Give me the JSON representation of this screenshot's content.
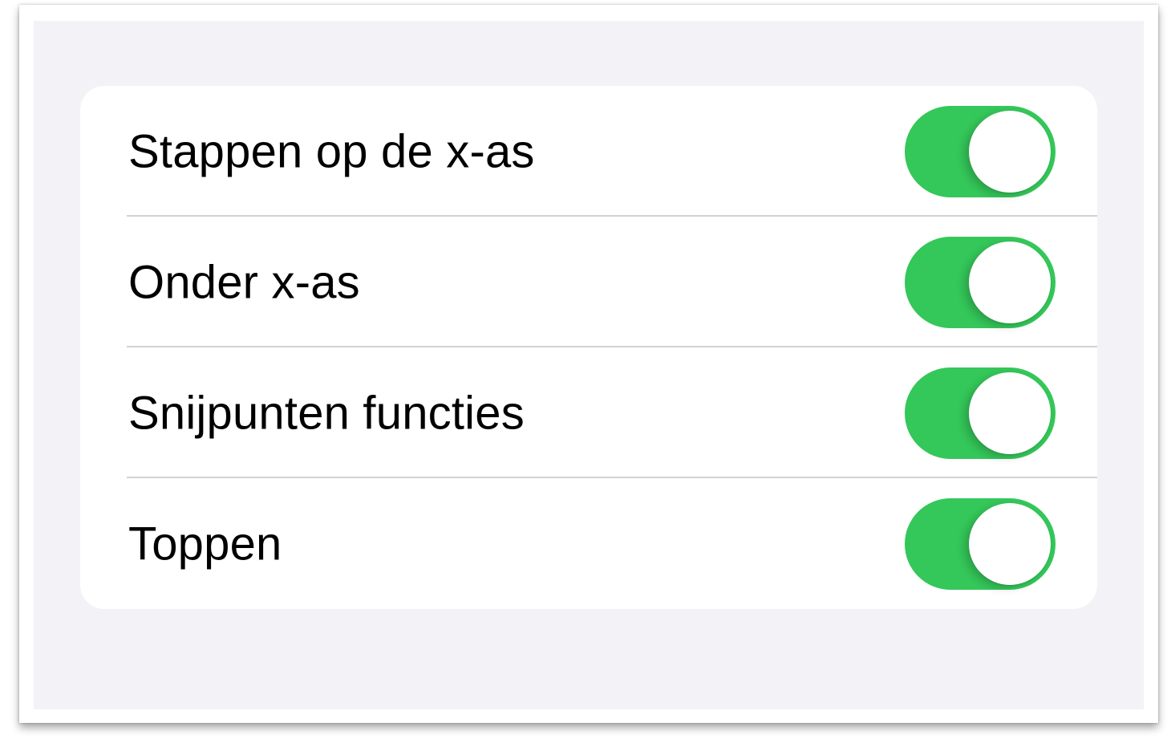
{
  "settings": {
    "accent_color": "#34c759",
    "rows": [
      {
        "label": "Stappen op de x-as",
        "on": true
      },
      {
        "label": "Onder x-as",
        "on": true
      },
      {
        "label": "Snijpunten functies",
        "on": true
      },
      {
        "label": "Toppen",
        "on": true
      }
    ]
  }
}
